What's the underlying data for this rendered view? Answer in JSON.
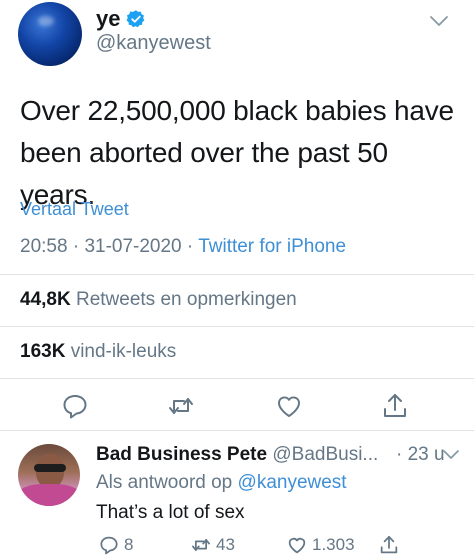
{
  "tweet": {
    "display_name": "ye",
    "handle": "@kanyewest",
    "text": "Over 22,500,000 black babies have been aborted over the past 50 years.",
    "translate_label": "Vertaal Tweet",
    "time": "20:58",
    "date": "31-07-2020",
    "separator": "·",
    "source": "Twitter for iPhone",
    "retweets_count": "44,8K",
    "retweets_label": "Retweets en opmerkingen",
    "likes_count": "163K",
    "likes_label": "vind-ik-leuks"
  },
  "reply": {
    "display_name": "Bad Business Pete",
    "handle": "@BadBusi...",
    "time": "· 23 u",
    "reply_to_prefix": "Als antwoord op",
    "reply_to_handle": "@kanyewest",
    "text": "That’s a lot of sex",
    "replies_count": "8",
    "retweets_count": "43",
    "likes_count": "1.303"
  },
  "colors": {
    "link": "#3e8fd6",
    "secondary_text": "#657786",
    "primary_text": "#14171a",
    "verified": "#1da1f2"
  }
}
